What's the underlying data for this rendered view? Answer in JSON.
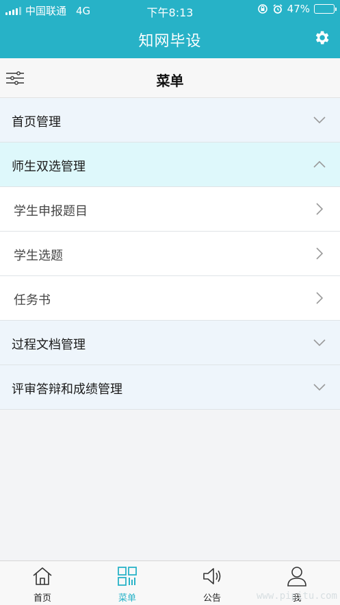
{
  "status": {
    "carrier": "中国联通",
    "network": "4G",
    "time": "下午8:13",
    "battery": "47%",
    "battery_fraction": 0.47
  },
  "header": {
    "title": "知网毕设",
    "settings_icon": "gear-icon"
  },
  "menu": {
    "title": "菜单",
    "filter_icon": "filter-sliders-icon"
  },
  "rows": [
    {
      "label": "首页管理",
      "kind": "category",
      "state": "collapsed"
    },
    {
      "label": "师生双选管理",
      "kind": "category",
      "state": "expanded"
    },
    {
      "label": "学生申报题目",
      "kind": "item"
    },
    {
      "label": "学生选题",
      "kind": "item"
    },
    {
      "label": "任务书",
      "kind": "item"
    },
    {
      "label": "过程文档管理",
      "kind": "category",
      "state": "collapsed"
    },
    {
      "label": "评审答辩和成绩管理",
      "kind": "category",
      "state": "collapsed"
    }
  ],
  "tabs": [
    {
      "label": "首页",
      "icon": "home-icon"
    },
    {
      "label": "菜单",
      "icon": "grid-icon",
      "active": true
    },
    {
      "label": "公告",
      "icon": "speaker-icon"
    },
    {
      "label": "我",
      "icon": "user-icon"
    }
  ],
  "colors": {
    "primary": "#27b2c7",
    "expanded_bg": "#def8fb",
    "category_bg": "#eef5fb"
  },
  "watermark": "www.pipitu.com"
}
